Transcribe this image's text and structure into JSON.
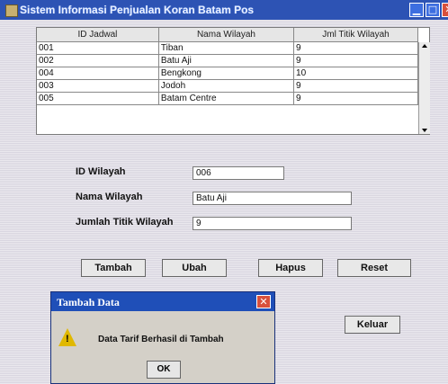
{
  "window": {
    "title": "Sistem Informasi Penjualan Koran Batam Pos",
    "icons": {
      "app": "coffee-cup-icon",
      "minimize": "minimize-icon",
      "maximize": "maximize-icon",
      "close": "close-icon"
    }
  },
  "table": {
    "headers": [
      "ID Jadwal",
      "Nama Wilayah",
      "Jml Titik Wilayah"
    ],
    "rows": [
      [
        "001",
        "Tiban",
        "9"
      ],
      [
        "002",
        "Batu Aji",
        "9"
      ],
      [
        "004",
        "Bengkong",
        "10"
      ],
      [
        "003",
        "Jodoh",
        "9"
      ],
      [
        "005",
        "Batam Centre",
        "9"
      ]
    ]
  },
  "form": {
    "id_label": "ID Wilayah",
    "id_value": "006",
    "nama_label": "Nama Wilayah",
    "nama_value": "Batu Aji",
    "jumlah_label": "Jumlah Titik Wilayah",
    "jumlah_value": "9"
  },
  "buttons": {
    "tambah": "Tambah",
    "ubah": "Ubah",
    "hapus": "Hapus",
    "reset": "Reset",
    "keluar": "Keluar"
  },
  "dialog": {
    "title": "Tambah Data",
    "message": "Data Tarif Berhasil di Tambah",
    "ok": "OK",
    "icon": "warning-icon"
  },
  "colors": {
    "titlebar": "#2d53b4",
    "dialog_titlebar": "#1f4fb8",
    "close_button": "#d8503c",
    "warning": "#e0b800"
  }
}
